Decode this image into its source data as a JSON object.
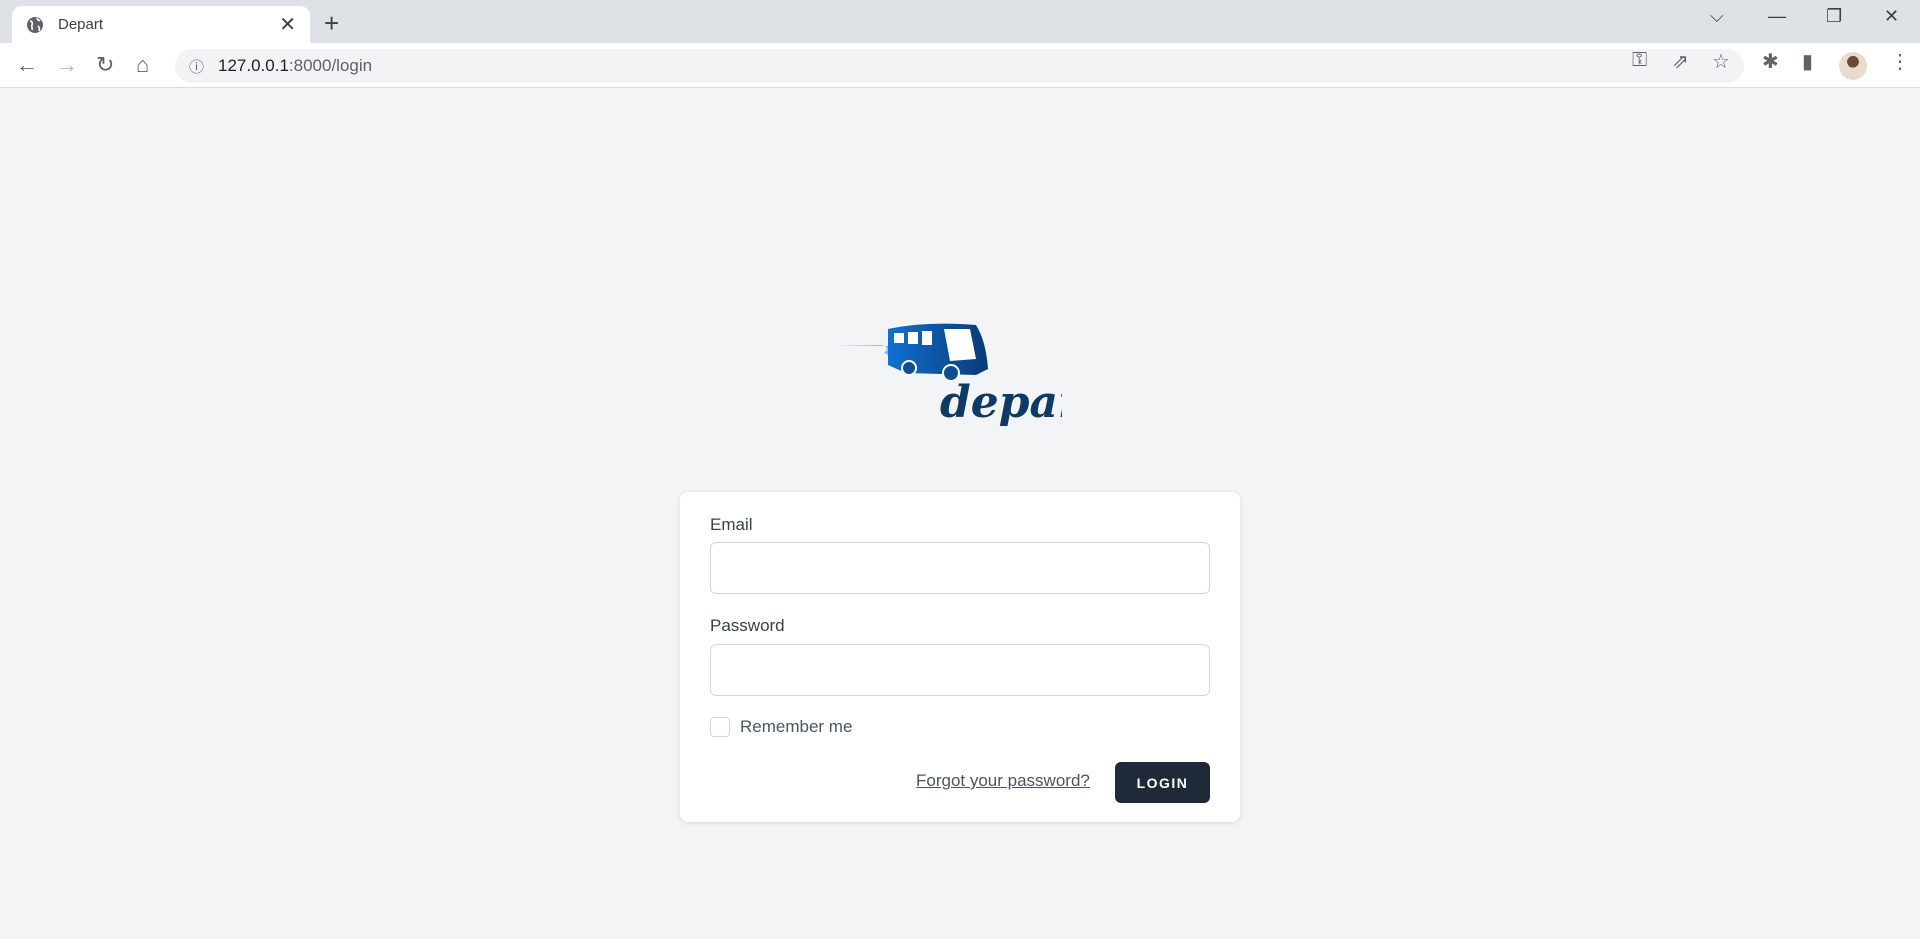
{
  "browser": {
    "tab_title": "Depart",
    "url_host": "127.0.0.1",
    "url_rest": ":8000/login"
  },
  "logo": {
    "text": "depart"
  },
  "form": {
    "email_label": "Email",
    "email_value": "",
    "password_label": "Password",
    "password_value": "",
    "remember_label": "Remember me",
    "remember_checked": false,
    "forgot_link": "Forgot your password?",
    "login_button": "LOGIN"
  },
  "colors": {
    "accent": "#1f2937",
    "background": "#f3f4f6"
  }
}
